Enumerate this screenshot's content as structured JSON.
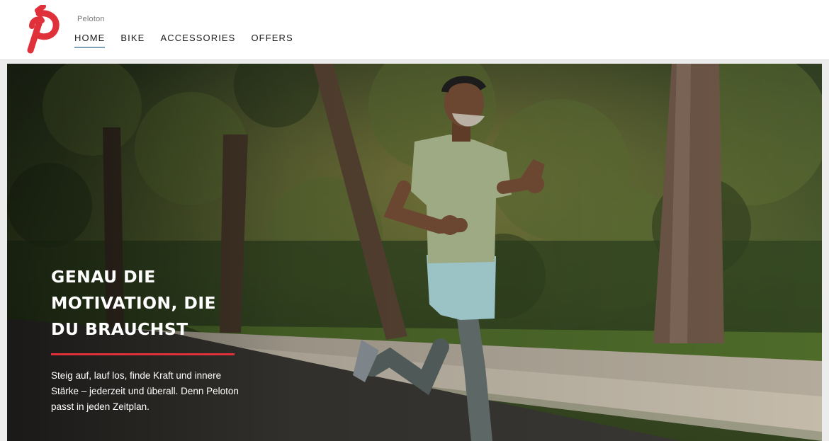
{
  "header": {
    "brand_name": "Peloton",
    "logo_icon": "peloton-p-logo-icon",
    "logo_color": "#e0313a",
    "nav": [
      {
        "label": "HOME",
        "active": true
      },
      {
        "label": "BIKE",
        "active": false
      },
      {
        "label": "ACCESSORIES",
        "active": false
      },
      {
        "label": "OFFERS",
        "active": false
      }
    ]
  },
  "hero": {
    "image": "runner-on-tree-lined-street-photo",
    "headline": "GENAU DIE MOTIVATION, DIE DU BRAUCHST",
    "accent_rule_color": "#e0313a",
    "subcopy": "Steig auf, lauf los, finde Kraft und innere Stärke – jederzeit und überall. Denn Peloton passt in jeden Zeitplan."
  }
}
